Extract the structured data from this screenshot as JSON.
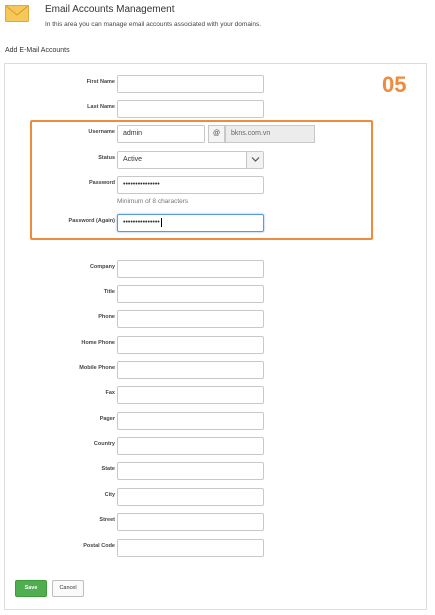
{
  "header": {
    "title": "Email Accounts Management",
    "description": "In this area you can manage email accounts associated with your domains.",
    "icon": "envelope-icon"
  },
  "section_label": "Add E-Mail Accounts",
  "badge": "05",
  "colors": {
    "accent": "#f08a3c",
    "save": "#4fae4f",
    "focus": "#5b9bd5"
  },
  "form": {
    "first_name": {
      "label": "First Name",
      "value": ""
    },
    "last_name": {
      "label": "Last Name",
      "value": ""
    },
    "username": {
      "label": "Username",
      "value": "admin",
      "at": "@",
      "domain": "bkns.com.vn"
    },
    "status": {
      "label": "Status",
      "value": "Active"
    },
    "password": {
      "label": "Password",
      "value": "•••••••••••••••",
      "hint": "Minimum of 8 characters"
    },
    "password_again": {
      "label": "Password (Again)",
      "value": "•••••••••••••••"
    },
    "company": {
      "label": "Company",
      "value": ""
    },
    "title": {
      "label": "Title",
      "value": ""
    },
    "phone": {
      "label": "Phone",
      "value": ""
    },
    "home_phone": {
      "label": "Home Phone",
      "value": ""
    },
    "mobile_phone": {
      "label": "Mobile Phone",
      "value": ""
    },
    "fax": {
      "label": "Fax",
      "value": ""
    },
    "pager": {
      "label": "Pager",
      "value": ""
    },
    "country": {
      "label": "Country",
      "value": ""
    },
    "state": {
      "label": "State",
      "value": ""
    },
    "city": {
      "label": "City",
      "value": ""
    },
    "street": {
      "label": "Street",
      "value": ""
    },
    "postal_code": {
      "label": "Postal Code",
      "value": ""
    }
  },
  "buttons": {
    "save": "Save",
    "cancel": "Cancel"
  }
}
